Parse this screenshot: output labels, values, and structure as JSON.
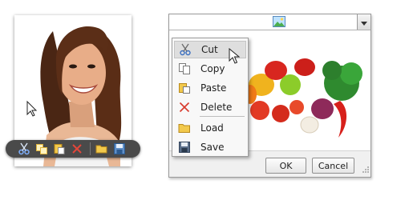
{
  "photo_card": {
    "toolbar": {
      "icons": [
        "scissors-icon",
        "copy-icon",
        "paste-icon",
        "delete-x-icon",
        "folder-open-icon",
        "save-floppy-icon"
      ]
    }
  },
  "window": {
    "combo": {
      "icon": "image-landscape-icon"
    },
    "buttons": {
      "ok_label": "OK",
      "cancel_label": "Cancel"
    }
  },
  "context_menu": {
    "items": [
      {
        "label": "Cut",
        "icon": "scissors-icon",
        "highlighted": true
      },
      {
        "label": "Copy",
        "icon": "copy-icon"
      },
      {
        "label": "Paste",
        "icon": "paste-icon"
      },
      {
        "label": "Delete",
        "icon": "delete-x-icon"
      },
      {
        "label": "Load",
        "icon": "folder-open-icon"
      },
      {
        "label": "Save",
        "icon": "save-floppy-icon"
      }
    ]
  },
  "colors": {
    "toolbar_bg": "#4a4a4a",
    "menu_bg": "#f8f8f8",
    "menu_hover": "#dedede",
    "delete_red": "#d83a2c",
    "folder_yellow": "#f2c94c",
    "scissors_blue": "#3b6fc0"
  }
}
